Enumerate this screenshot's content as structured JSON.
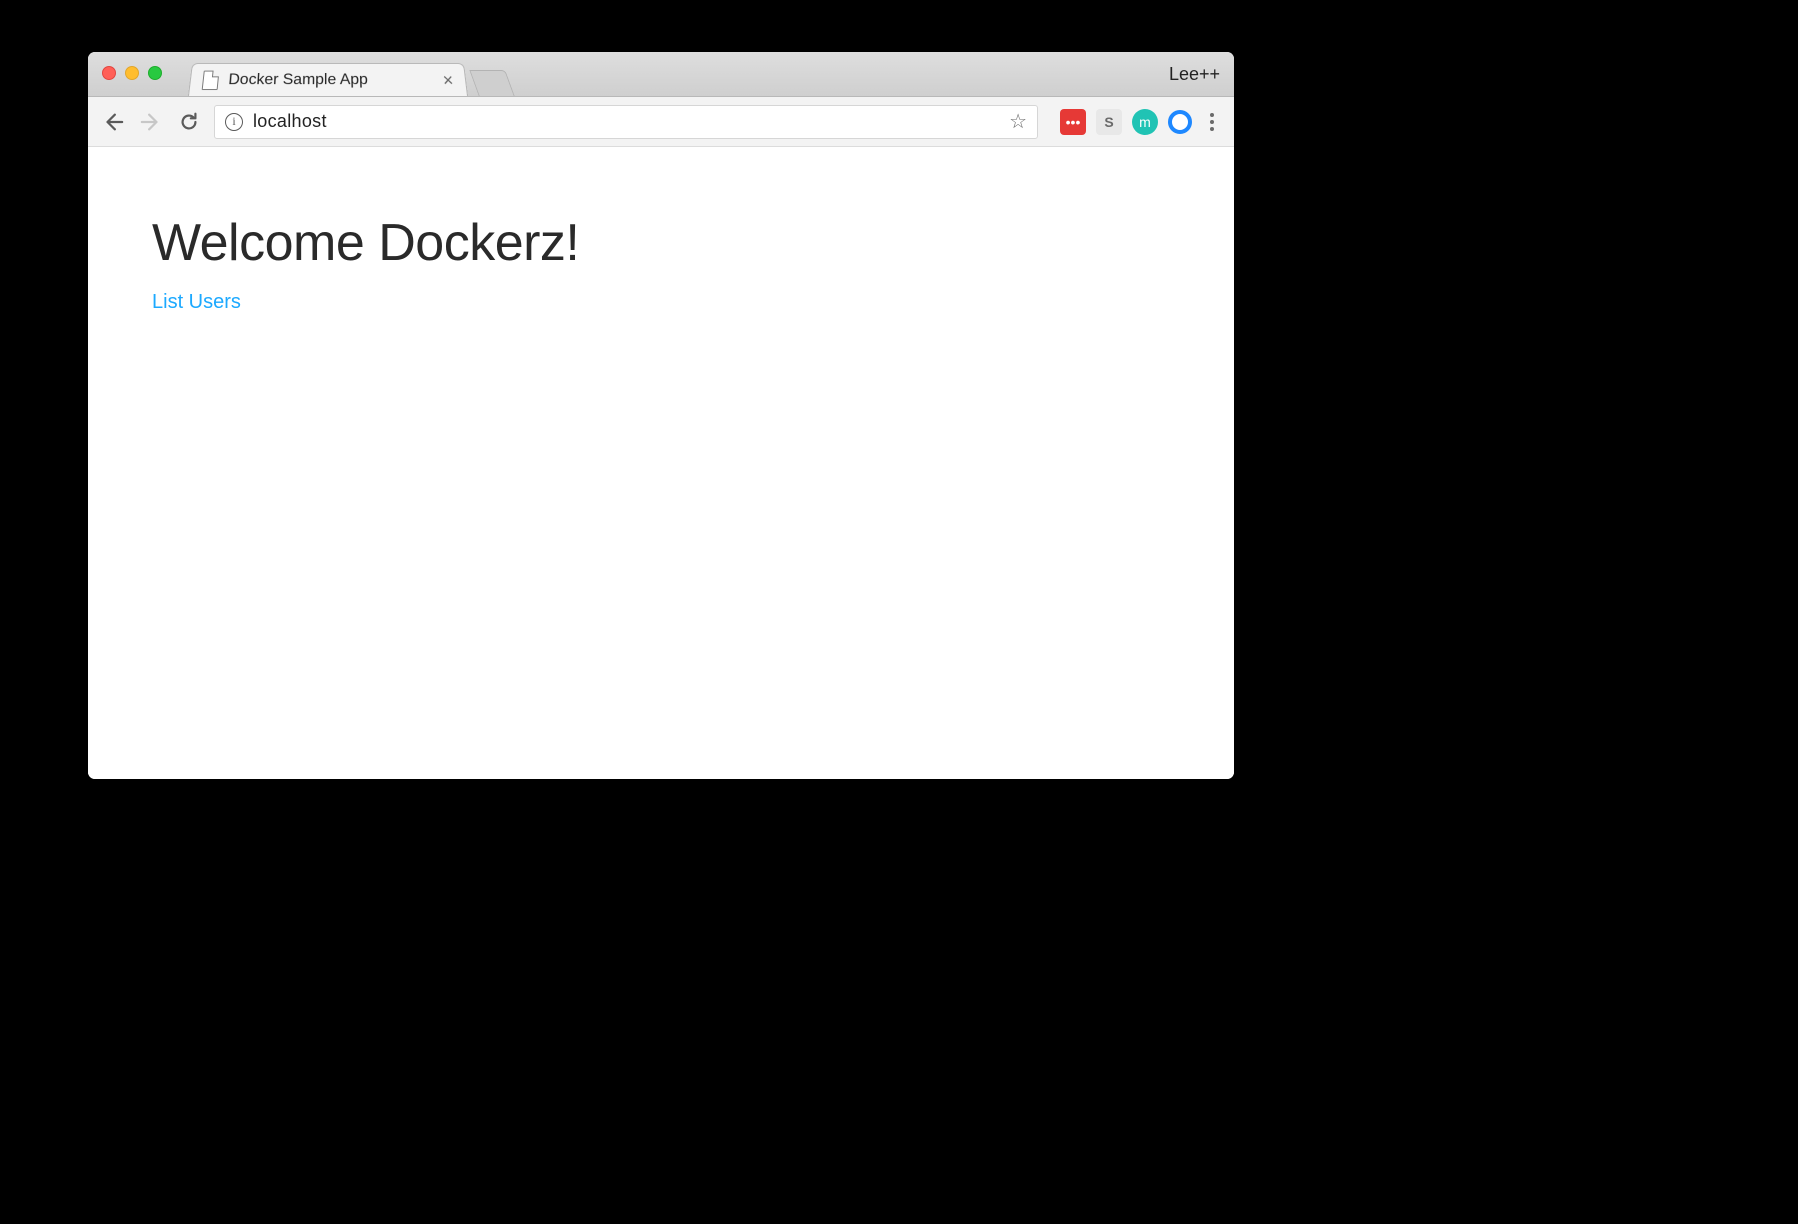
{
  "window": {
    "profile_name": "Lee++"
  },
  "tab": {
    "title": "Docker Sample App"
  },
  "omnibox": {
    "url": "localhost",
    "info_glyph": "i"
  },
  "extensions": {
    "red_dots": "•••",
    "s_label": "S",
    "m_label": "m"
  },
  "page": {
    "heading": "Welcome Dockerz!",
    "link_text": "List Users"
  }
}
